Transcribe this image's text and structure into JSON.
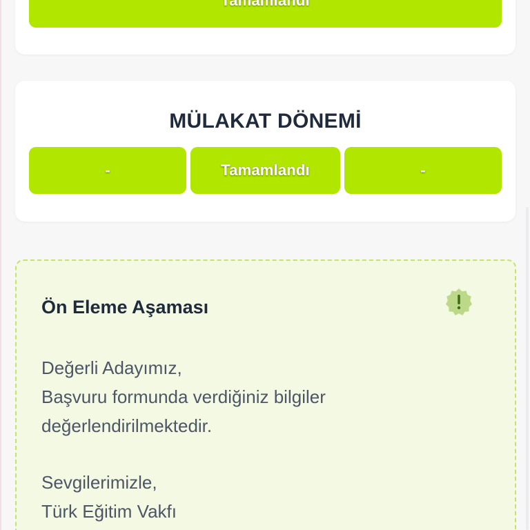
{
  "top_card": {
    "status_label": "Tamamlandı"
  },
  "mulakat": {
    "title": "MÜLAKAT DÖNEMİ",
    "stages": [
      "-",
      "Tamamlandı",
      "-"
    ]
  },
  "notice": {
    "title": "Ön Eleme Aşaması",
    "icon": "exclamation-badge-icon",
    "lines1": [
      "Değerli Adayımız,",
      "Başvuru formunda verdiğiniz bilgiler",
      "değerlendirilmektedir."
    ],
    "lines2": [
      "Sevgilerimizle,",
      "Türk Eğitim Vakfı"
    ]
  },
  "colors": {
    "accent": "#b0e600",
    "notice_bg": "#f3f9e2",
    "notice_border": "#c2e46a",
    "title_text": "#1f2a3d"
  }
}
